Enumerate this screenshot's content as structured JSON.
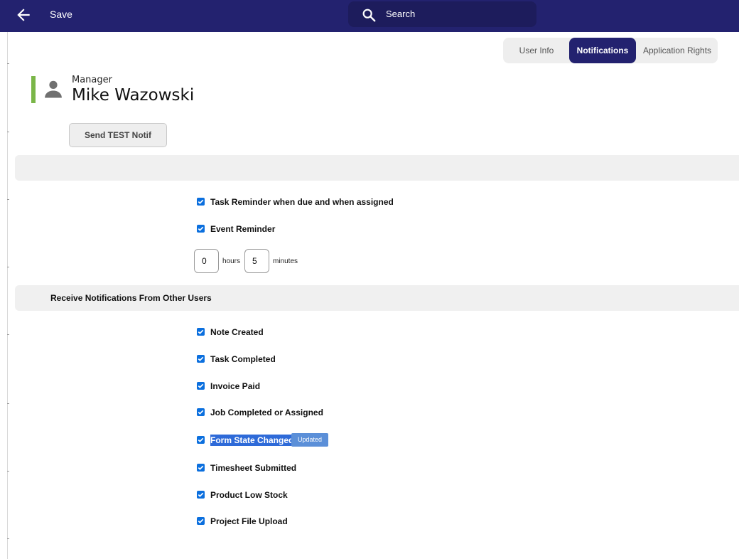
{
  "topbar": {
    "back_icon": "arrow-left-icon",
    "save_label": "Save",
    "search_placeholder": "Search",
    "search_icon": "search-icon"
  },
  "tabs": [
    {
      "label": "User Info",
      "active": false
    },
    {
      "label": "Notifications",
      "active": true
    },
    {
      "label": "Application Rights",
      "active": false
    }
  ],
  "profile": {
    "role": "Manager",
    "name": "Mike Wazowski",
    "avatar_icon": "person-icon",
    "accent_color": "#7ab648"
  },
  "test_button_label": "Send TEST Notif",
  "reminders": {
    "items": [
      {
        "label": "Task Reminder when due and when assigned",
        "checked": true
      },
      {
        "label": "Event Reminder",
        "checked": true
      }
    ],
    "hours_value": "0",
    "hours_label": "hours",
    "minutes_value": "5",
    "minutes_label": "minutes"
  },
  "other_users": {
    "title": "Receive Notifications From Other Users",
    "items": [
      {
        "label": "Note Created",
        "checked": true
      },
      {
        "label": "Task Completed",
        "checked": true
      },
      {
        "label": "Invoice Paid",
        "checked": true
      },
      {
        "label": "Job Completed or Assigned",
        "checked": true
      },
      {
        "label": "Form State Changed",
        "checked": true,
        "badge": "Updated"
      },
      {
        "label": "Timesheet Submitted",
        "checked": true
      },
      {
        "label": "Product Low Stock",
        "checked": true
      },
      {
        "label": "Project File Upload",
        "checked": true
      }
    ]
  },
  "colors": {
    "header": "#23226f",
    "checkbox": "#0b6fde",
    "badge": "#5b8fd8"
  }
}
